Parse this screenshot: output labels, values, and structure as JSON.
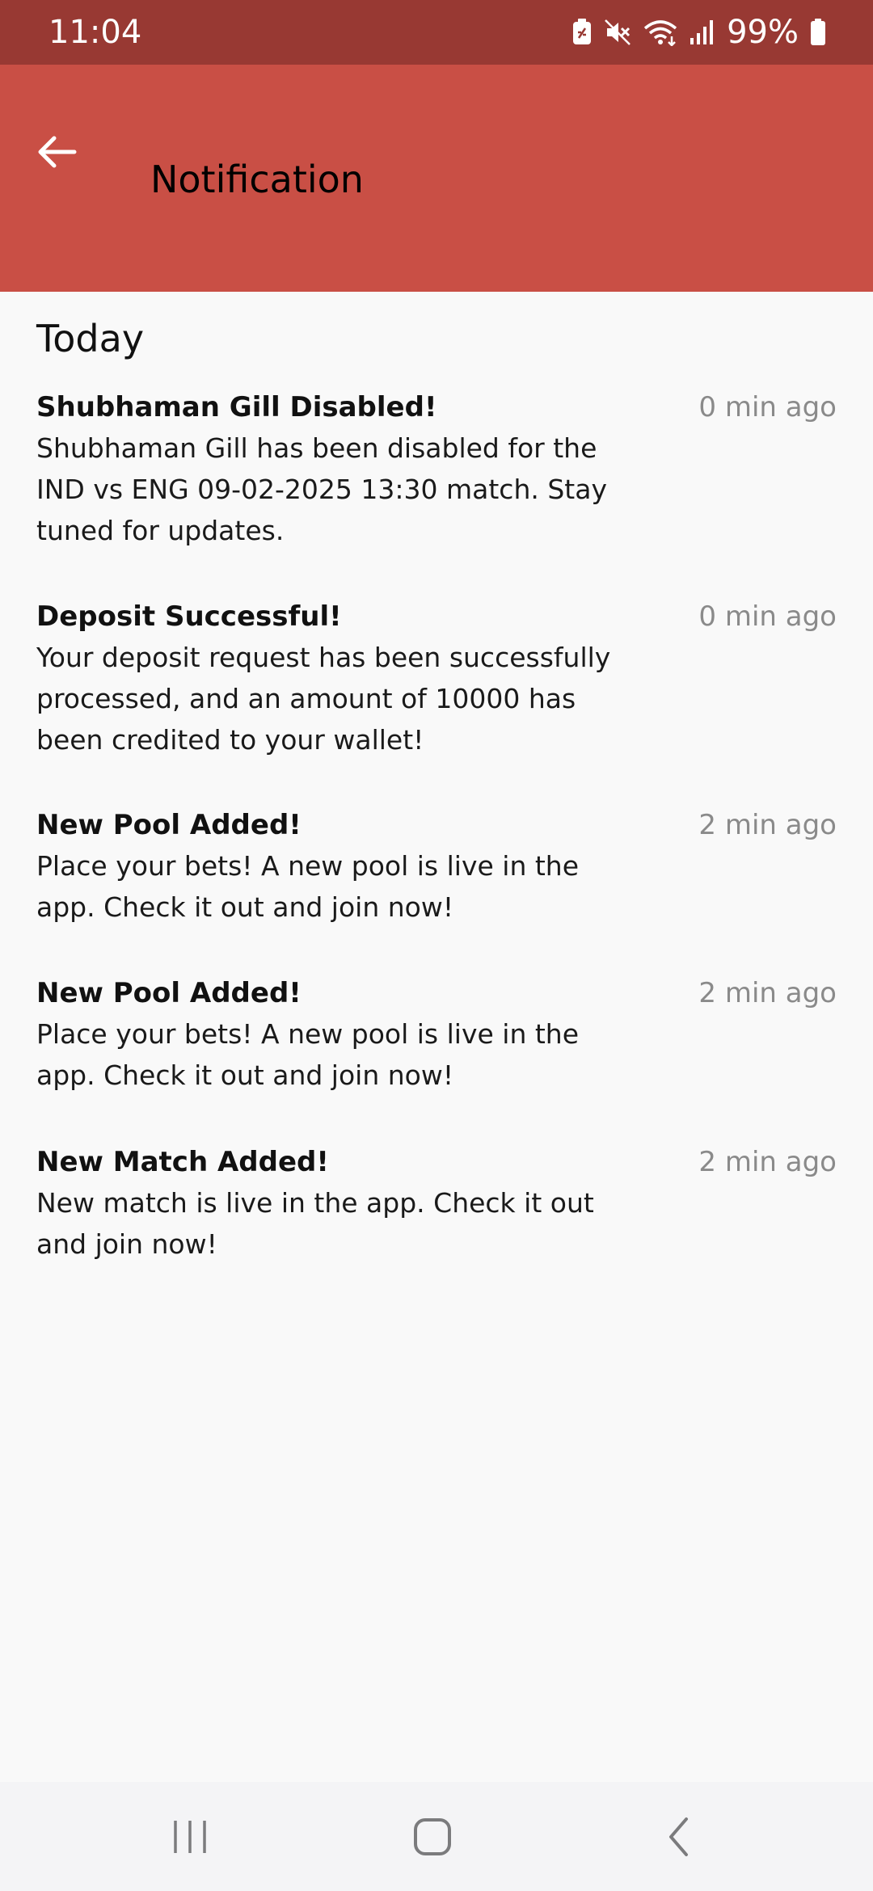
{
  "status_bar": {
    "time": "11:04",
    "battery": "99%",
    "icons": [
      "battery-saver-icon",
      "mute-icon",
      "wifi-icon",
      "signal-icon",
      "battery-icon"
    ]
  },
  "header": {
    "title": "Notification",
    "back_icon": "arrow-left-icon",
    "color": "#c94f45",
    "status_color": "#983933"
  },
  "section": {
    "title": "Today"
  },
  "notifications": [
    {
      "title": "Shubhaman Gill Disabled!",
      "time": "0 min ago",
      "body": "Shubhaman Gill has been disabled for the IND vs ENG 09-02-2025 13:30 match. Stay tuned for updates."
    },
    {
      "title": "Deposit Successful!",
      "time": "0 min ago",
      "body": "Your deposit request has been successfully processed, and an amount of 10000 has been credited to your wallet!"
    },
    {
      "title": "New Pool Added!",
      "time": "2 min ago",
      "body": "Place your bets! A new pool is live in the app. Check it out and join now!"
    },
    {
      "title": "New Pool Added!",
      "time": "2 min ago",
      "body": "Place your bets! A new pool is live in the app. Check it out and join now!"
    },
    {
      "title": "New Match Added!",
      "time": "2 min ago",
      "body": "New match is live in the app. Check it out and join now!"
    }
  ],
  "nav_bar": {
    "icons": [
      "recent-apps-icon",
      "home-icon",
      "back-icon"
    ]
  }
}
